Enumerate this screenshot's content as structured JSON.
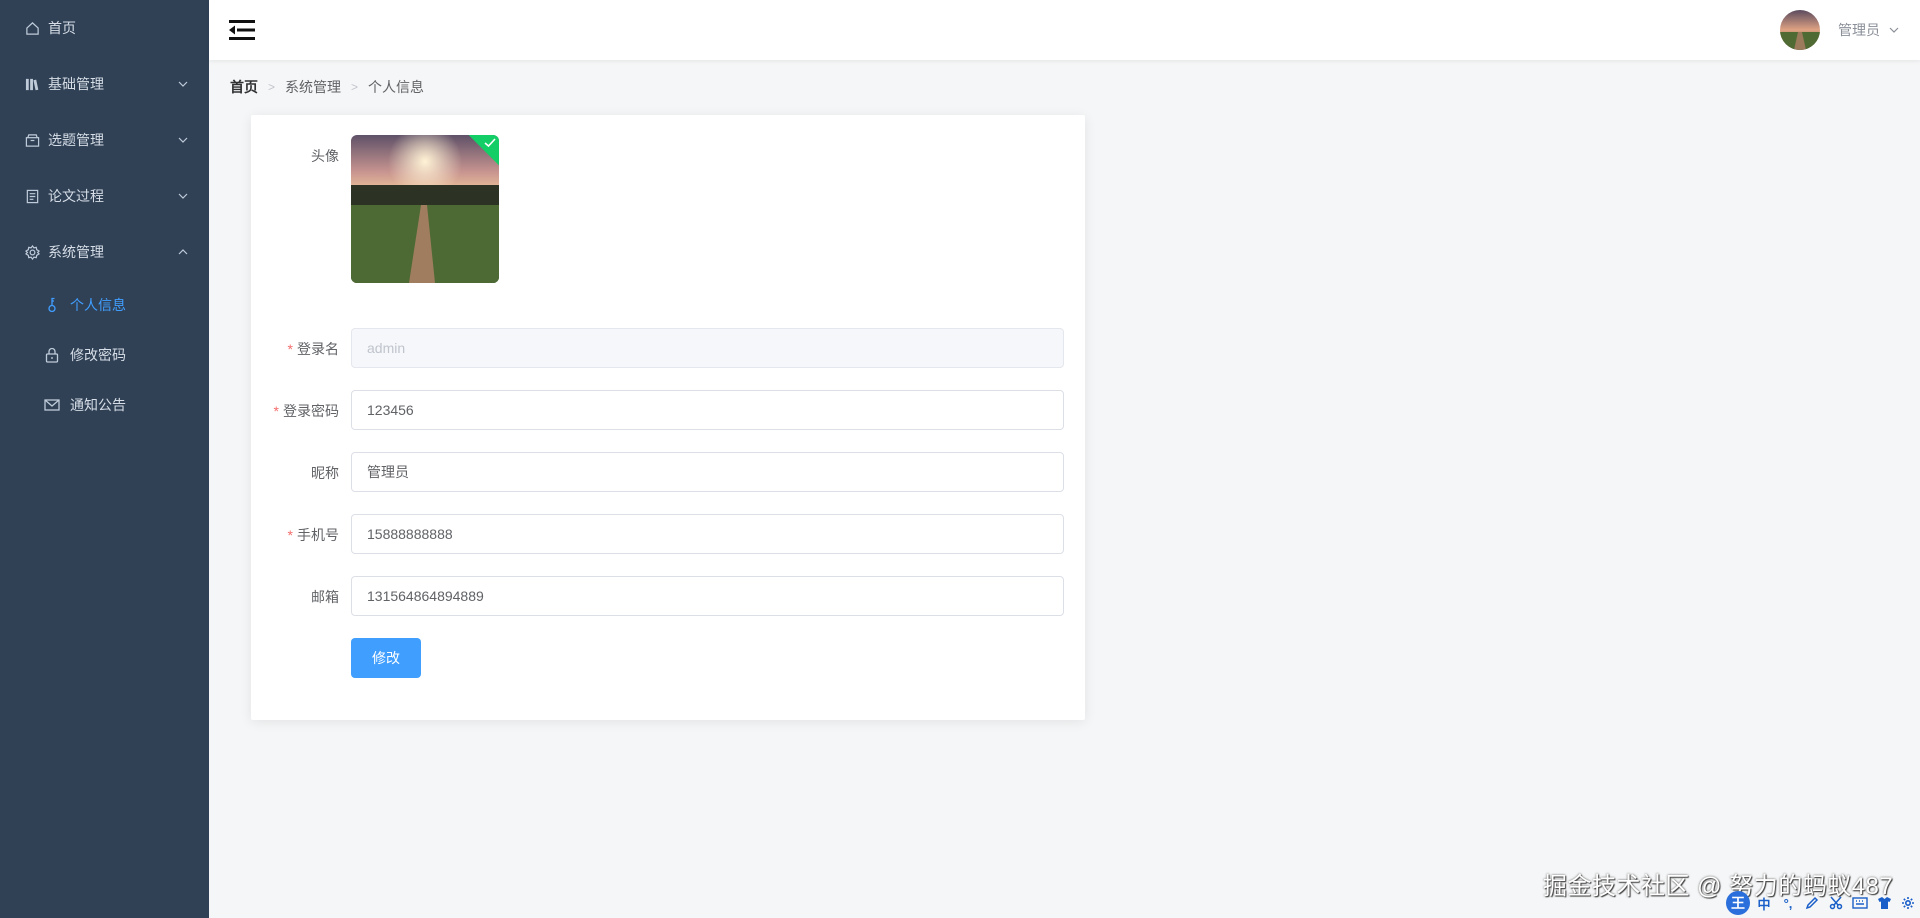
{
  "sidebar": {
    "items": [
      {
        "label": "首页",
        "icon": "home-icon"
      },
      {
        "label": "基础管理",
        "icon": "library-icon"
      },
      {
        "label": "选题管理",
        "icon": "box-icon"
      },
      {
        "label": "论文过程",
        "icon": "document-icon"
      },
      {
        "label": "系统管理",
        "icon": "gear-icon"
      }
    ],
    "subitems": [
      {
        "label": "个人信息",
        "icon": "key-icon",
        "active": true
      },
      {
        "label": "修改密码",
        "icon": "lock-icon"
      },
      {
        "label": "通知公告",
        "icon": "mail-icon"
      }
    ]
  },
  "header": {
    "username": "管理员"
  },
  "breadcrumb": [
    "首页",
    "系统管理",
    "个人信息"
  ],
  "form": {
    "avatar_label": "头像",
    "login_name_label": "登录名",
    "login_name_value": "admin",
    "password_label": "登录密码",
    "password_value": "123456",
    "nickname_label": "昵称",
    "nickname_value": "管理员",
    "phone_label": "手机号",
    "phone_value": "15888888888",
    "email_label": "邮箱",
    "email_value": "131564864894889",
    "submit_label": "修改"
  },
  "watermark": "掘金技术社区 @ 努力的蚂蚁487",
  "ime": {
    "logo": "王",
    "lang": "中"
  },
  "colors": {
    "sidebar_bg": "#304156",
    "accent": "#409eff",
    "success": "#13ce66",
    "required": "#f56c6c"
  }
}
